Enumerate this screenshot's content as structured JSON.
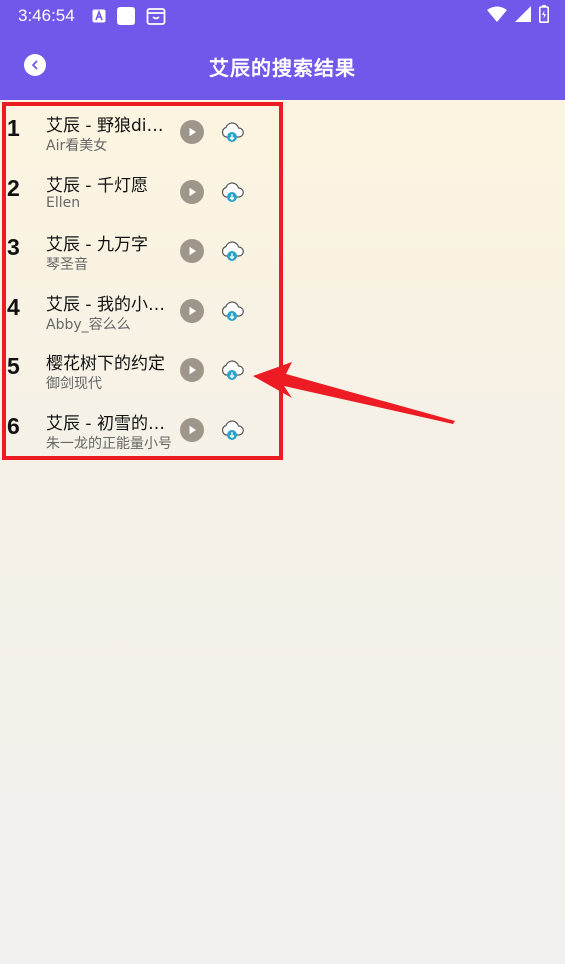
{
  "status_bar": {
    "time": "3:46:54",
    "left_icons": [
      "a-letter-icon",
      "square-icon",
      "briefcase-icon"
    ],
    "right_icons": [
      "wifi-icon",
      "signal-icon",
      "battery-icon"
    ]
  },
  "header": {
    "title": "艾辰的搜索结果",
    "back_icon": "back-arrow-icon"
  },
  "songs": [
    {
      "rank": "1",
      "title": "艾辰 - 野狼disco",
      "singer": "Air看美女"
    },
    {
      "rank": "2",
      "title": "艾辰 - 千灯愿",
      "singer": "Ellen"
    },
    {
      "rank": "3",
      "title": "艾辰 - 九万字",
      "singer": "琴圣音"
    },
    {
      "rank": "4",
      "title": "艾辰 - 我的小可爱",
      "singer": "Abby_容么么"
    },
    {
      "rank": "5",
      "title": "樱花树下的约定",
      "singer": "御剑现代"
    },
    {
      "rank": "6",
      "title": "艾辰 - 初雪的约定",
      "singer": "朱一龙的正能量小号"
    }
  ],
  "colors": {
    "header_bg": "#7157ea",
    "highlight": "#ec1b24",
    "play_button": "#9e968b",
    "download_accent": "#2ba3c9"
  },
  "annotation": {
    "highlight_target": "song-list",
    "arrow_points_to": "download-button row 5"
  }
}
